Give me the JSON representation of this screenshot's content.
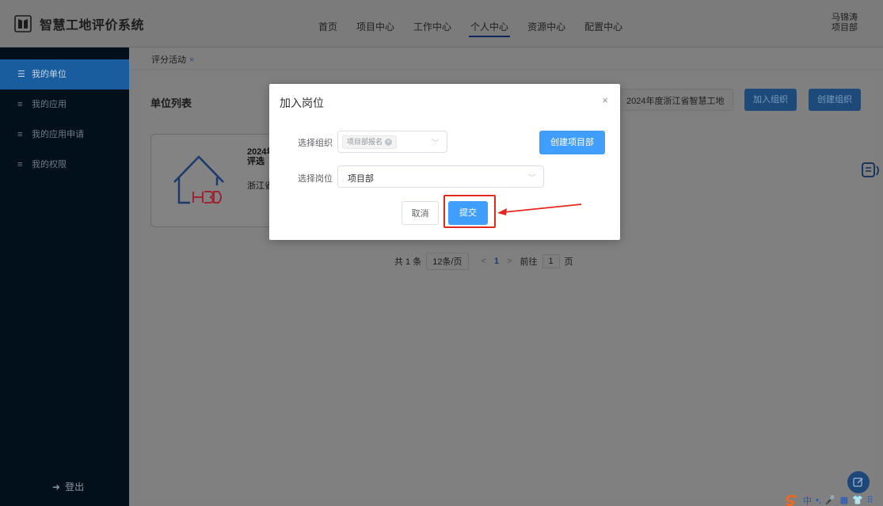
{
  "app": {
    "title": "智慧工地评价系统"
  },
  "topnav": {
    "items": [
      "首页",
      "项目中心",
      "工作中心",
      "个人中心",
      "资源中心",
      "配置中心"
    ],
    "active_index": 3
  },
  "user": {
    "name": "马锦涛",
    "role": "项目部"
  },
  "sidebar": {
    "items": [
      {
        "label": "我的单位",
        "icon": "list-icon"
      },
      {
        "label": "我的应用",
        "icon": "menu-icon"
      },
      {
        "label": "我的应用申请",
        "icon": "menu-icon"
      },
      {
        "label": "我的权限",
        "icon": "menu-icon"
      }
    ],
    "active_index": 0,
    "logout_label": "登出"
  },
  "tabs": {
    "active_label": "评分活动",
    "close_glyph": "×"
  },
  "main": {
    "section_title": "单位列表",
    "search_value": "2024年度浙江省智慧工地",
    "join_org_label": "加入组织",
    "create_org_label": "创建组织",
    "card": {
      "name_line1": "2024年",
      "name_line2": "评选",
      "org": "浙江省"
    },
    "pager": {
      "total": "共 1 条",
      "page_size": "12条/页",
      "prev": "<",
      "current": "1",
      "next": ">",
      "goto_label": "前往",
      "goto_value": "1",
      "page_unit": "页"
    }
  },
  "dialog": {
    "title": "加入岗位",
    "close_glyph": "×",
    "org_label": "选择组织",
    "org_tag": "项目部报名",
    "org_tag_clear": "×",
    "create_dept_label": "创建项目部",
    "post_label": "选择岗位",
    "post_value": "项目部",
    "cancel_label": "取消",
    "submit_label": "提交"
  },
  "ime": {
    "items": [
      "中",
      "•,",
      "🎤",
      "▦",
      "👕",
      "⠿"
    ]
  },
  "colors": {
    "primary": "#409eff",
    "sidebar_bg": "#02101c",
    "sidebar_active": "#1a5d9f",
    "highlight_red": "#e4281d"
  }
}
